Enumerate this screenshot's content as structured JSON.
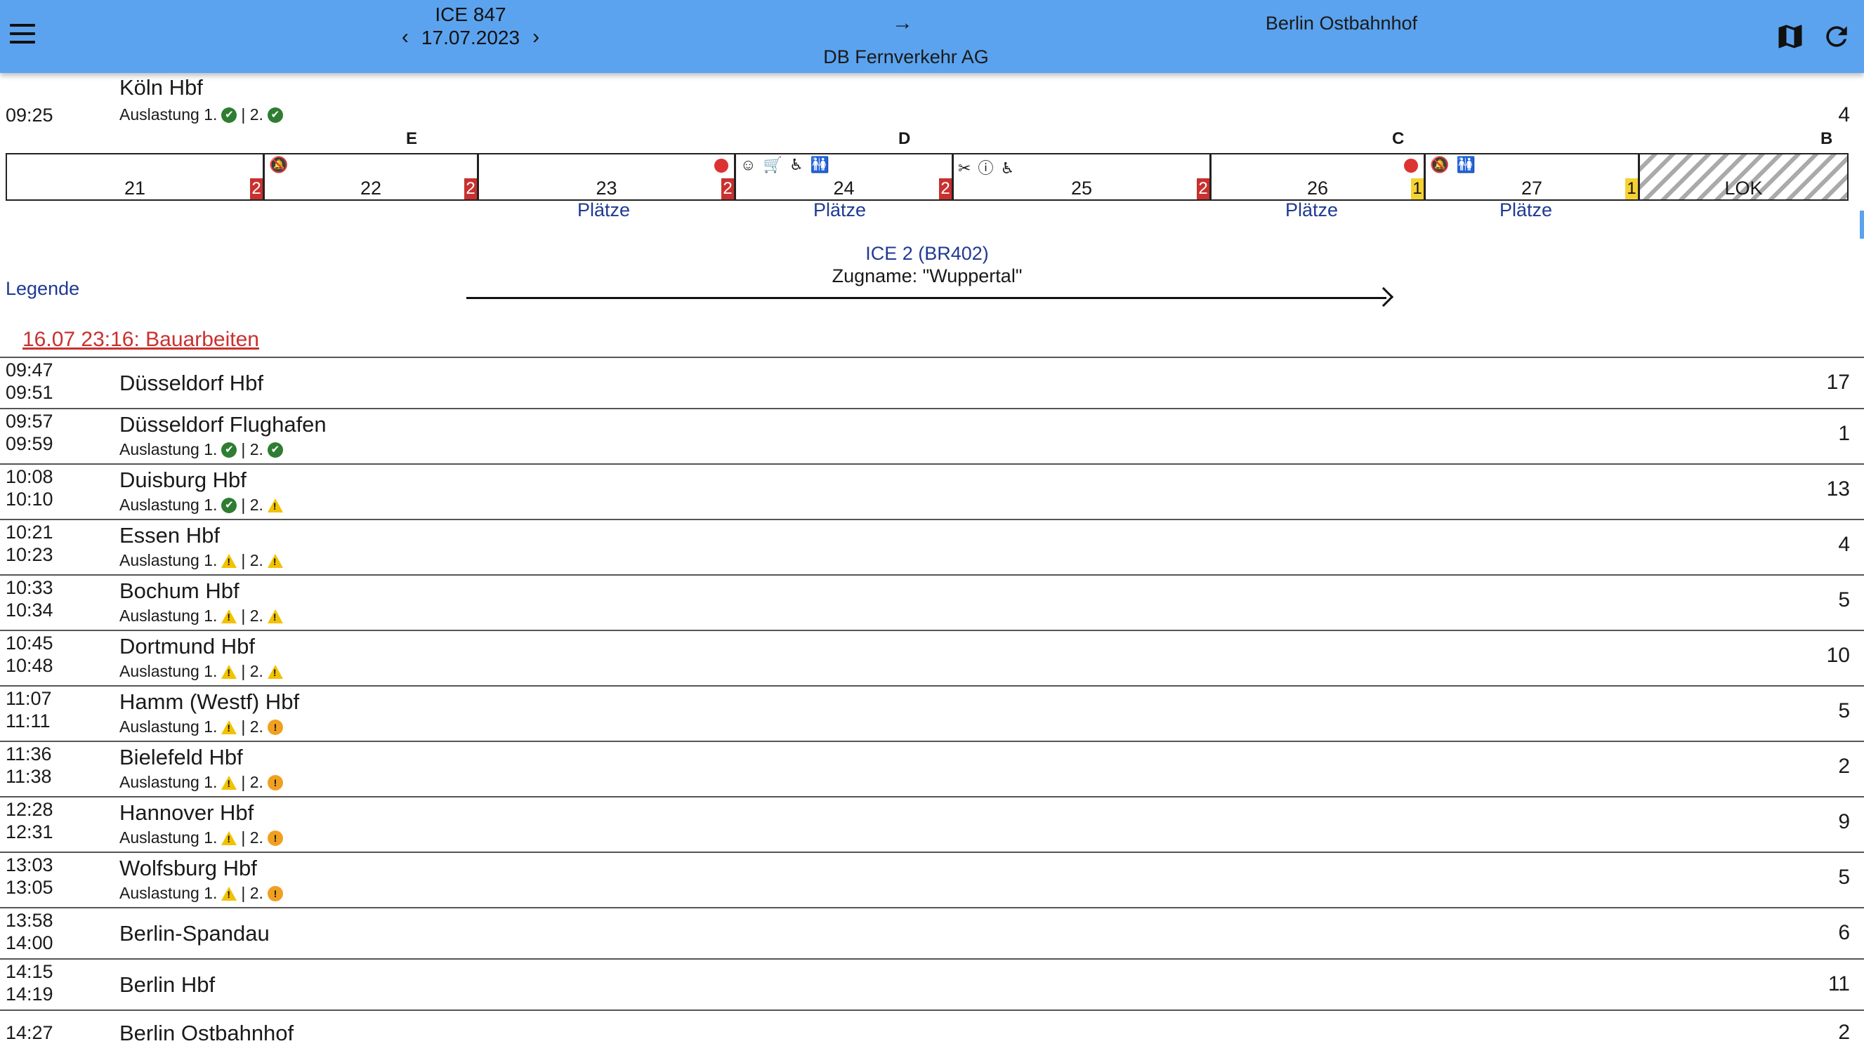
{
  "header": {
    "train": "ICE 847",
    "date": "17.07.2023",
    "prev": "‹",
    "next": "›",
    "arrow": "→",
    "operator": "DB Fernverkehr AG",
    "destination": "Berlin Ostbahnhof",
    "colors": {
      "bar": "#5ba3ee"
    }
  },
  "origin": {
    "name": "Köln Hbf",
    "time": "09:25",
    "track": "4",
    "load": {
      "label": "Auslastung 1.",
      "sep": "| 2.",
      "first": "ok",
      "second": "ok"
    }
  },
  "sectors": [
    "E",
    "D",
    "C",
    "B"
  ],
  "wagons": [
    {
      "num": "21",
      "cls": "2",
      "icons": ""
    },
    {
      "num": "22",
      "cls": "2",
      "icons": "🔕"
    },
    {
      "num": "23",
      "cls": "2",
      "icons": "",
      "dot": true,
      "seats": "Plätze"
    },
    {
      "num": "24",
      "cls": "2",
      "icons": "☺ 🛒 ♿ 🚻",
      "seats": "Plätze"
    },
    {
      "num": "25",
      "cls": "2",
      "icons": "✂ ⓘ ♿"
    },
    {
      "num": "26",
      "cls": "1",
      "icons": "",
      "dot": true,
      "seats": "Plätze"
    },
    {
      "num": "27",
      "cls": "1",
      "icons": "🔕 🚻",
      "seats": "Plätze"
    }
  ],
  "lok": "LOK",
  "train_info": {
    "type": "ICE 2 (BR402)",
    "name": "Zugname: \"Wuppertal\""
  },
  "legend": "Legende",
  "notice": "16.07 23:16: Bauarbeiten",
  "load_labels": {
    "first": "Auslastung 1.",
    "sep": "| 2."
  },
  "stops": [
    {
      "arr": "09:47",
      "dep": "09:51",
      "name": "Düsseldorf Hbf",
      "track": "17"
    },
    {
      "arr": "09:57",
      "dep": "09:59",
      "name": "Düsseldorf Flughafen",
      "track": "1",
      "load": [
        "ok",
        "ok"
      ]
    },
    {
      "arr": "10:08",
      "dep": "10:10",
      "name": "Duisburg Hbf",
      "track": "13",
      "load": [
        "ok",
        "warn"
      ]
    },
    {
      "arr": "10:21",
      "dep": "10:23",
      "name": "Essen Hbf",
      "track": "4",
      "load": [
        "warn",
        "warn"
      ]
    },
    {
      "arr": "10:33",
      "dep": "10:34",
      "name": "Bochum Hbf",
      "track": "5",
      "load": [
        "warn",
        "warn"
      ]
    },
    {
      "arr": "10:45",
      "dep": "10:48",
      "name": "Dortmund Hbf",
      "track": "10",
      "load": [
        "warn",
        "warn"
      ]
    },
    {
      "arr": "11:07",
      "dep": "11:11",
      "name": "Hamm (Westf) Hbf",
      "track": "5",
      "load": [
        "warn",
        "high"
      ]
    },
    {
      "arr": "11:36",
      "dep": "11:38",
      "name": "Bielefeld Hbf",
      "track": "2",
      "load": [
        "warn",
        "high"
      ]
    },
    {
      "arr": "12:28",
      "dep": "12:31",
      "name": "Hannover Hbf",
      "track": "9",
      "load": [
        "warn",
        "high"
      ]
    },
    {
      "arr": "13:03",
      "dep": "13:05",
      "name": "Wolfsburg Hbf",
      "track": "5",
      "load": [
        "warn",
        "high"
      ]
    },
    {
      "arr": "13:58",
      "dep": "14:00",
      "name": "Berlin-Spandau",
      "track": "6"
    },
    {
      "arr": "14:15",
      "dep": "14:19",
      "name": "Berlin Hbf",
      "track": "11"
    },
    {
      "arr": "14:27",
      "dep": "",
      "name": "Berlin Ostbahnhof",
      "track": "2"
    }
  ]
}
